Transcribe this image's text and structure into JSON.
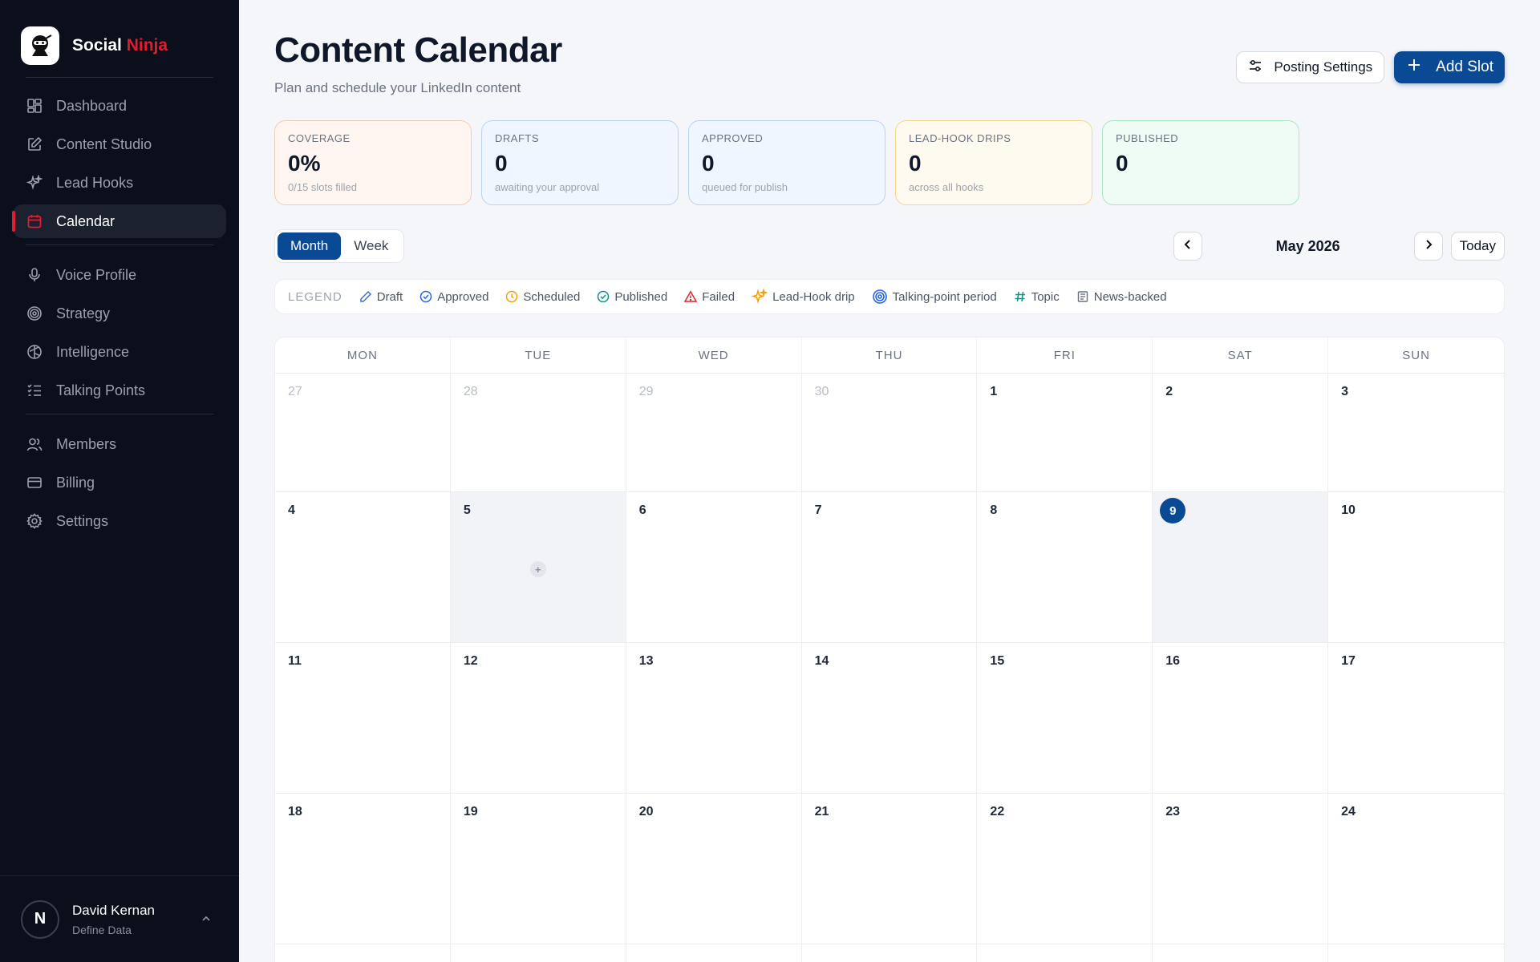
{
  "brand": {
    "name_part1": "Social",
    "name_part2": "Ninja"
  },
  "sidebar": {
    "groups": [
      [
        {
          "label": "Dashboard",
          "icon": "dashboard-icon"
        },
        {
          "label": "Content Studio",
          "icon": "edit-icon"
        },
        {
          "label": "Lead Hooks",
          "icon": "sparkle-icon"
        },
        {
          "label": "Calendar",
          "icon": "calendar-icon",
          "active": true
        }
      ],
      [
        {
          "label": "Voice Profile",
          "icon": "mic-icon"
        },
        {
          "label": "Strategy",
          "icon": "target-icon"
        },
        {
          "label": "Intelligence",
          "icon": "brain-icon"
        },
        {
          "label": "Talking Points",
          "icon": "list-check-icon"
        }
      ],
      [
        {
          "label": "Members",
          "icon": "users-icon"
        },
        {
          "label": "Billing",
          "icon": "card-icon"
        },
        {
          "label": "Settings",
          "icon": "gear-icon"
        }
      ]
    ],
    "user": {
      "initial": "N",
      "name": "David Kernan",
      "org": "Define Data"
    }
  },
  "header": {
    "title": "Content Calendar",
    "subtitle": "Plan and schedule your LinkedIn content",
    "posting_settings": "Posting Settings",
    "add_slot": "Add Slot"
  },
  "stats": [
    {
      "label": "COVERAGE",
      "value": "0%",
      "sub": "0/15 slots filled",
      "bg": "#fff6f2",
      "border": "#f6cbb6"
    },
    {
      "label": "DRAFTS",
      "value": "0",
      "sub": "awaiting your approval",
      "bg": "#f0f6ff",
      "border": "#b9d3f3"
    },
    {
      "label": "APPROVED",
      "value": "0",
      "sub": "queued for publish",
      "bg": "#f0f6ff",
      "border": "#b9d3f3"
    },
    {
      "label": "LEAD-HOOK DRIPS",
      "value": "0",
      "sub": "across all hooks",
      "bg": "#fffaef",
      "border": "#f6d58f"
    },
    {
      "label": "PUBLISHED",
      "value": "0",
      "sub": "",
      "bg": "#effcf5",
      "border": "#a9e6c4"
    }
  ],
  "view_toggle": {
    "month": "Month",
    "week": "Week"
  },
  "month_nav": {
    "label": "May 2026",
    "today": "Today"
  },
  "legend": {
    "title": "LEGEND",
    "items": [
      {
        "label": "Draft",
        "icon": "pencil-icon",
        "color": "#3b6fd1"
      },
      {
        "label": "Approved",
        "icon": "check-circle-icon",
        "color": "#2563eb"
      },
      {
        "label": "Scheduled",
        "icon": "clock-icon",
        "color": "#f59e0b"
      },
      {
        "label": "Published",
        "icon": "check-circle-icon",
        "color": "#0d9488"
      },
      {
        "label": "Failed",
        "icon": "warning-icon",
        "color": "#dc2626"
      },
      {
        "label": "Lead-Hook drip",
        "icon": "sparkle-icon",
        "color": "#f59e0b"
      },
      {
        "label": "Talking-point period",
        "icon": "target-icon",
        "color": "#2563eb"
      },
      {
        "label": "Topic",
        "icon": "hash-icon",
        "color": "#0d9488"
      },
      {
        "label": "News-backed",
        "icon": "newspaper-icon",
        "color": "#6b7280"
      }
    ]
  },
  "calendar": {
    "weekdays": [
      "MON",
      "TUE",
      "WED",
      "THU",
      "FRI",
      "SAT",
      "SUN"
    ],
    "days": [
      {
        "d": "27",
        "muted": true
      },
      {
        "d": "28",
        "muted": true
      },
      {
        "d": "29",
        "muted": true
      },
      {
        "d": "30",
        "muted": true
      },
      {
        "d": "1"
      },
      {
        "d": "2"
      },
      {
        "d": "3"
      },
      {
        "d": "4"
      },
      {
        "d": "5",
        "highlight": true,
        "add": true
      },
      {
        "d": "6"
      },
      {
        "d": "7"
      },
      {
        "d": "8"
      },
      {
        "d": "9",
        "today": true,
        "highlight": true
      },
      {
        "d": "10"
      },
      {
        "d": "11"
      },
      {
        "d": "12"
      },
      {
        "d": "13"
      },
      {
        "d": "14"
      },
      {
        "d": "15"
      },
      {
        "d": "16"
      },
      {
        "d": "17"
      },
      {
        "d": "18"
      },
      {
        "d": "19"
      },
      {
        "d": "20"
      },
      {
        "d": "21"
      },
      {
        "d": "22"
      },
      {
        "d": "23"
      },
      {
        "d": "24"
      },
      {
        "d": ""
      },
      {
        "d": ""
      },
      {
        "d": ""
      },
      {
        "d": ""
      },
      {
        "d": ""
      },
      {
        "d": ""
      },
      {
        "d": ""
      }
    ],
    "add_symbol": "+"
  }
}
